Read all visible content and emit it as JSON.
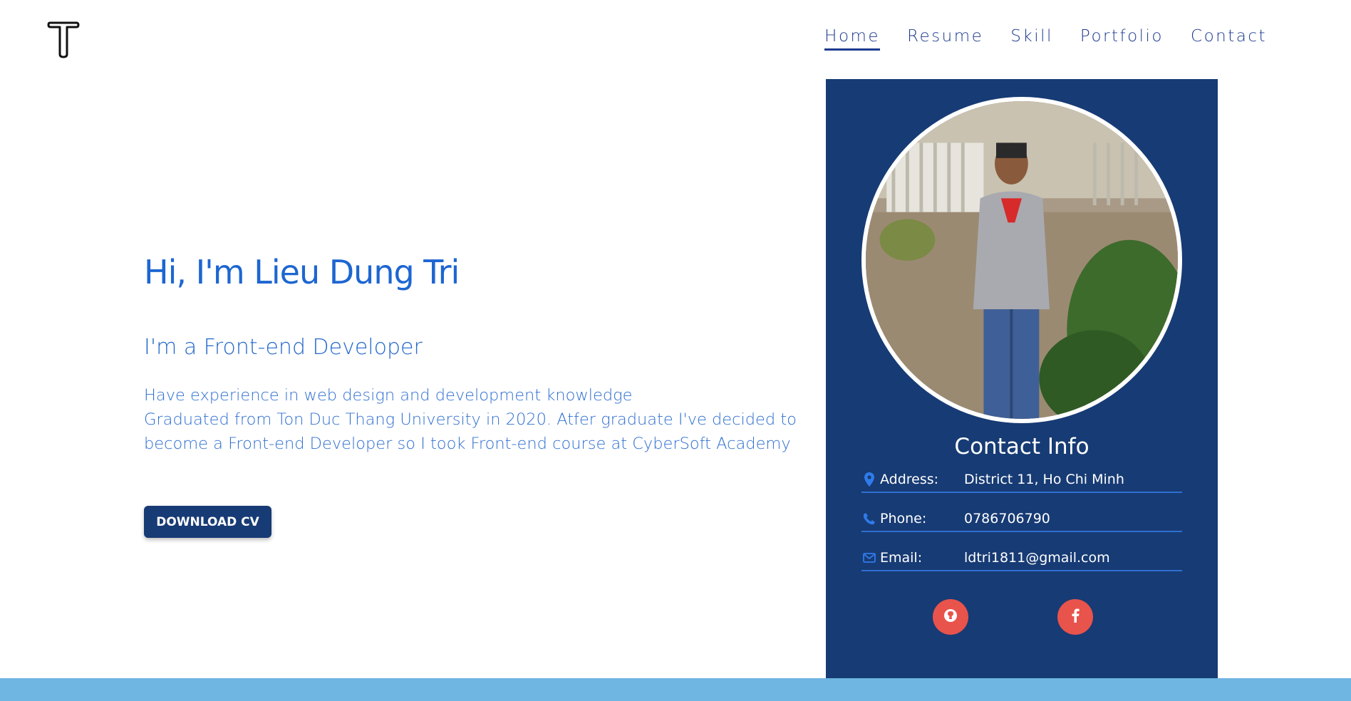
{
  "nav": {
    "items": [
      {
        "label": "Home",
        "active": true
      },
      {
        "label": "Resume",
        "active": false
      },
      {
        "label": "Skill",
        "active": false
      },
      {
        "label": "Portfolio",
        "active": false
      },
      {
        "label": "Contact",
        "active": false
      }
    ]
  },
  "hero": {
    "title": "Hi, I'm Lieu Dung Tri",
    "subtitle": "I'm a Front-end Developer",
    "desc_lines": [
      "Have experience in web design and development knowledge",
      "Graduated from Ton Duc Thang University in 2020. Atfer graduate I've decided to",
      "become a Front-end Developer so I took Front-end course at CyberSoft Academy"
    ],
    "download_label": "DOWNLOAD CV"
  },
  "contact": {
    "title": "Contact Info",
    "rows": [
      {
        "icon": "map-marker-icon",
        "label": "Address:",
        "value": "District 11, Ho Chi Minh"
      },
      {
        "icon": "phone-icon",
        "label": "Phone:",
        "value": "0786706790"
      },
      {
        "icon": "envelope-icon",
        "label": "Email:",
        "value": "ldtri1811@gmail.com"
      }
    ],
    "social": [
      {
        "icon": "github-icon"
      },
      {
        "icon": "facebook-icon"
      }
    ]
  },
  "colors": {
    "primary": "#1d66d1",
    "card_bg": "#173b74",
    "accent_red": "#e8534c",
    "band": "#6fb6e2"
  }
}
